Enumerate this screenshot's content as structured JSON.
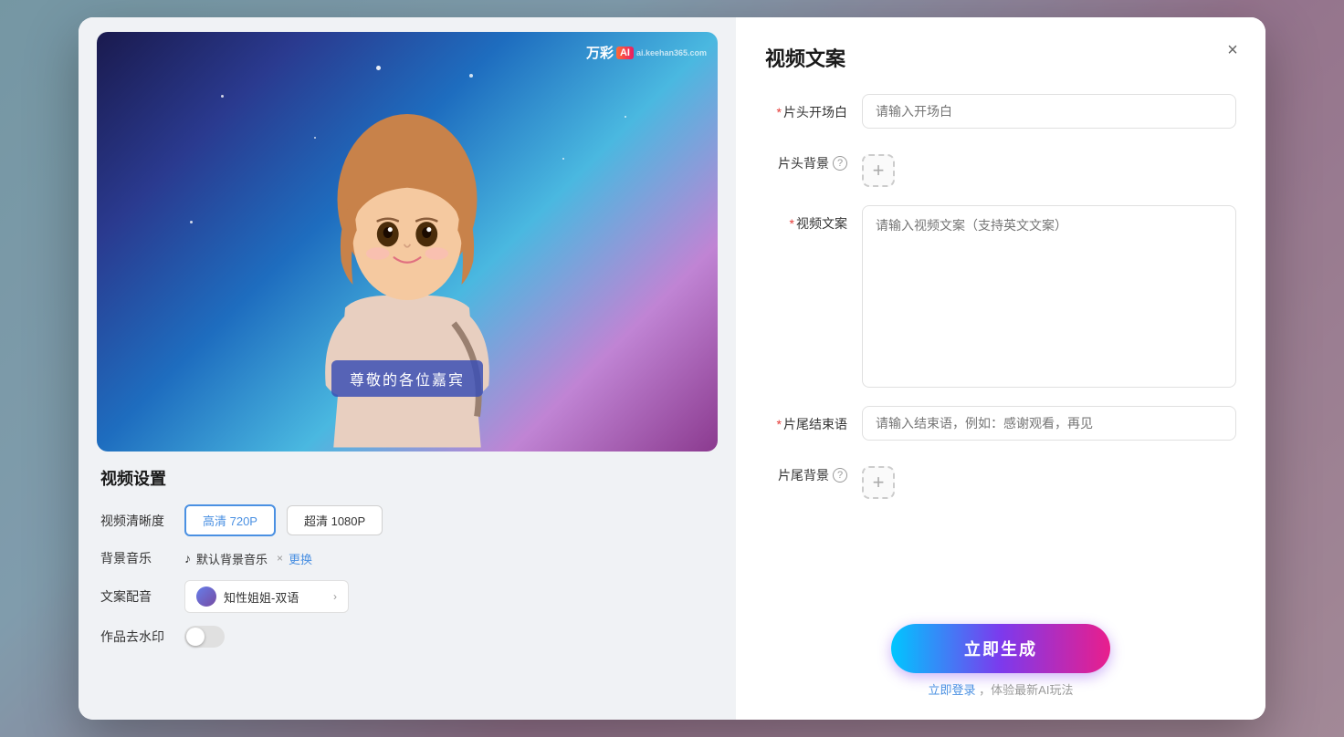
{
  "modal": {
    "left": {
      "subtitle": "尊敬的各位嘉宾",
      "watermark_text": "万彩",
      "watermark_sub": "ai.keehan365.com",
      "settings_title": "视频设置",
      "quality_label": "视频清晰度",
      "quality_options": [
        {
          "label": "高清 720P",
          "active": true
        },
        {
          "label": "超清 1080P",
          "active": false
        }
      ],
      "music_label": "背景音乐",
      "music_note_icon": "♪",
      "music_name": "默认背景音乐",
      "music_remove": "×",
      "music_change": "更换",
      "voice_label": "文案配音",
      "voice_name": "知性姐姐-双语",
      "voice_arrow": "›",
      "watermark_label": "作品去水印"
    },
    "right": {
      "title": "视频文案",
      "close_icon": "×",
      "fields": [
        {
          "key": "opening",
          "label": "片头开场白",
          "required": true,
          "type": "input",
          "placeholder": "请输入开场白"
        },
        {
          "key": "header_bg",
          "label": "片头背景",
          "required": false,
          "type": "background"
        },
        {
          "key": "content",
          "label": "视频文案",
          "required": true,
          "type": "textarea",
          "placeholder": "请输入视频文案（支持英文文案）"
        },
        {
          "key": "closing",
          "label": "片尾结束语",
          "required": true,
          "type": "input",
          "placeholder": "请输入结束语，例如：感谢观看，再见"
        },
        {
          "key": "footer_bg",
          "label": "片尾背景",
          "required": false,
          "type": "background"
        }
      ],
      "generate_btn": "立即生成",
      "login_hint": "立即登录，体验最新AI玩法",
      "login_link": "立即登录"
    }
  }
}
